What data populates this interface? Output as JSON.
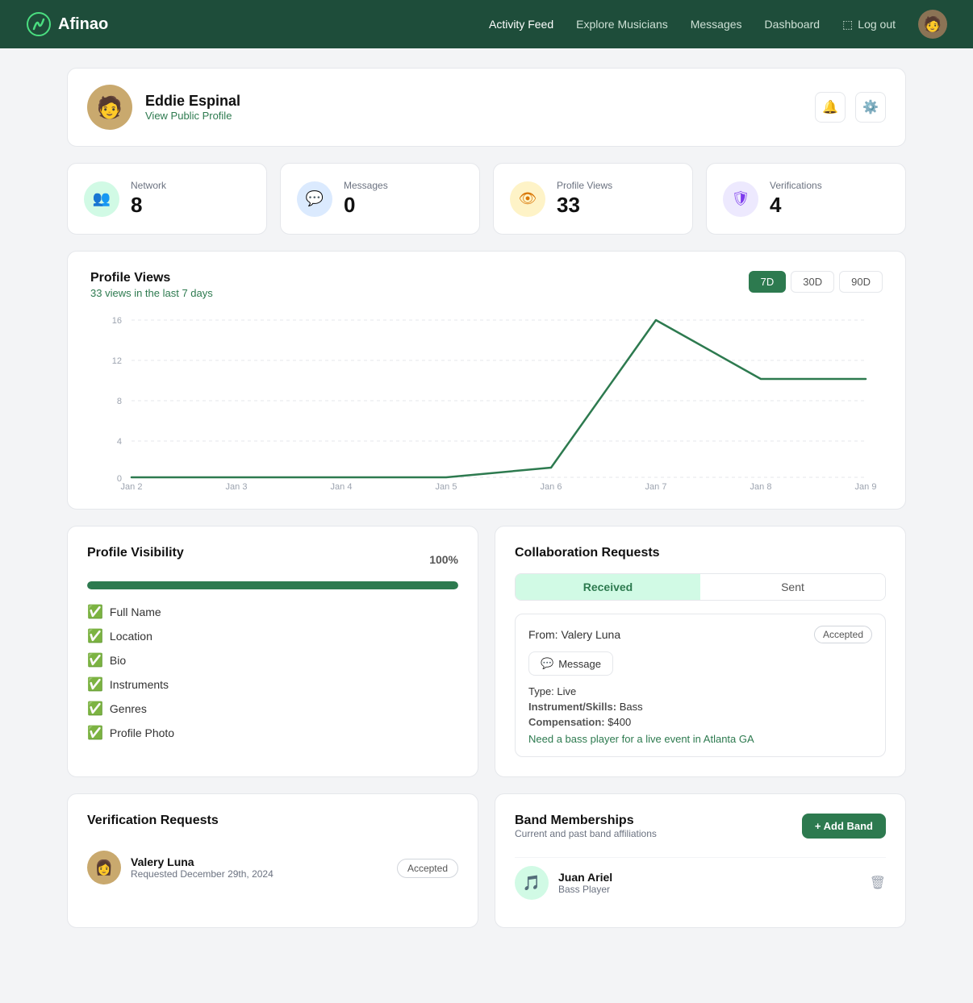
{
  "nav": {
    "logo": "Afinao",
    "links": [
      {
        "label": "Activity Feed",
        "active": true
      },
      {
        "label": "Explore Musicians",
        "active": false
      },
      {
        "label": "Messages",
        "active": false
      },
      {
        "label": "Dashboard",
        "active": false
      }
    ],
    "logout": "Log out"
  },
  "profile": {
    "name": "Eddie Espinal",
    "link": "View Public Profile"
  },
  "stats": [
    {
      "label": "Network",
      "value": "8",
      "icon": "👥",
      "color": "green"
    },
    {
      "label": "Messages",
      "value": "0",
      "icon": "💬",
      "color": "blue"
    },
    {
      "label": "Profile Views",
      "value": "33",
      "icon": "👁",
      "color": "yellow"
    },
    {
      "label": "Verifications",
      "value": "4",
      "icon": "🛡",
      "color": "purple"
    }
  ],
  "chart": {
    "title": "Profile Views",
    "subtitle": "33 views in the last 7 days",
    "period_active": "7D",
    "periods": [
      "7D",
      "30D",
      "90D"
    ],
    "x_labels": [
      "Jan 2",
      "Jan 3",
      "Jan 4",
      "Jan 5",
      "Jan 6",
      "Jan 7",
      "Jan 8",
      "Jan 9"
    ],
    "y_labels": [
      "0",
      "4",
      "8",
      "12",
      "16"
    ]
  },
  "visibility": {
    "title": "Profile Visibility",
    "percentage": "100%",
    "fill_width": "100",
    "items": [
      "Full Name",
      "Location",
      "Bio",
      "Instruments",
      "Genres",
      "Profile Photo"
    ]
  },
  "collaboration": {
    "title": "Collaboration Requests",
    "tabs": [
      "Received",
      "Sent"
    ],
    "active_tab": "Received",
    "item": {
      "from": "From: Valery Luna",
      "badge": "Accepted",
      "message_btn": "Message",
      "type_label": "Type:",
      "type_value": "Live",
      "instrument_label": "Instrument/Skills:",
      "instrument_value": "Bass",
      "compensation_label": "Compensation:",
      "compensation_value": "$400",
      "note": "Need a bass player for a live event in Atlanta GA"
    }
  },
  "verification": {
    "title": "Verification Requests",
    "item": {
      "name": "Valery Luna",
      "date": "Requested December 29th, 2024",
      "badge": "Accepted"
    }
  },
  "band": {
    "title": "Band Memberships",
    "subtitle": "Current and past band affiliations",
    "add_btn": "+ Add Band",
    "item": {
      "name": "Juan Ariel",
      "role": "Bass Player"
    }
  }
}
